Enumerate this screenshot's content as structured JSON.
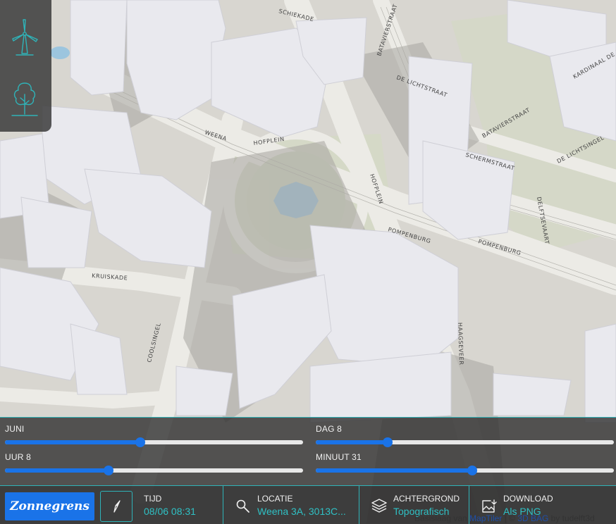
{
  "sliders": {
    "month": {
      "label": "JUNI",
      "value": 6,
      "min": 1,
      "max": 12
    },
    "day": {
      "label": "DAG 8",
      "value": 8,
      "min": 1,
      "max": 30
    },
    "hour": {
      "label": "UUR 8",
      "value": 8,
      "min": 0,
      "max": 23
    },
    "minute": {
      "label": "MINUUT 31",
      "value": 31,
      "min": 0,
      "max": 59
    }
  },
  "bottombar": {
    "logo": "Zonnegrens",
    "time": {
      "label": "TIJD",
      "value": "08/06 08:31"
    },
    "location": {
      "label": "LOCATIE",
      "value": "Weena 3A, 3013C..."
    },
    "background": {
      "label": "ACHTERGROND",
      "value": "Topografisch"
    },
    "download": {
      "label": "DOWNLOAD",
      "value": "Als PNG"
    }
  },
  "attribution": {
    "prefix": "Basislaag van",
    "maptiler": "MapTiler",
    "separator": " | © ",
    "bag": "3D BAG",
    "by": " by tudelft3d"
  },
  "map": {
    "streets": [
      "WEENA",
      "HOFPLEIN",
      "KRUISKADE",
      "COOLSINGEL",
      "HOFPLEIN",
      "POMPENBURG",
      "POMPENBURG",
      "HAAGSEVEER",
      "SCHIEKADE",
      "DE LICHTSTRAAT",
      "BATAVIERSTRAAT",
      "KARDINAAL DE JONGPLEIN",
      "DE LICHTSINGEL",
      "DELFTSEVAART",
      "SCHERMSTRAAT",
      "BATAVIERSTRAAT"
    ],
    "colors": {
      "ground": "#d9d7d1",
      "road": "#ecebe6",
      "building": "#e9e9ee",
      "water": "#9cc5de",
      "accent": "#2fb3b8",
      "primary": "#1a73e8"
    }
  },
  "tools": {
    "top": "wind-turbine-icon",
    "bottom": "tree-icon"
  }
}
